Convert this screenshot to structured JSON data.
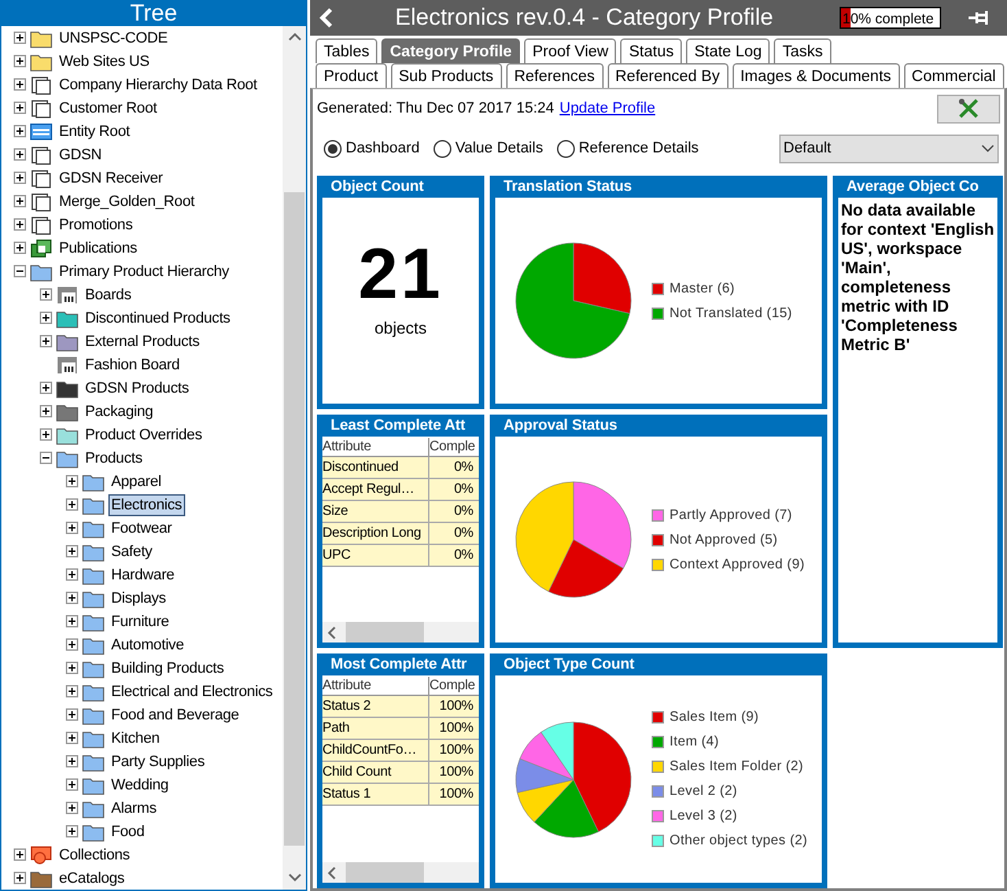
{
  "tree_panel": {
    "title": "Tree",
    "items": [
      {
        "label": "UNSPSC-CODE",
        "kind": "folder",
        "color": "#f9dc6b",
        "expanded": false,
        "selected": false
      },
      {
        "label": "Web Sites US",
        "kind": "folder",
        "color": "#f9dc6b",
        "expanded": false,
        "selected": false
      },
      {
        "label": "Company Hierarchy Data Root",
        "kind": "box",
        "expanded": false,
        "selected": false
      },
      {
        "label": "Customer Root",
        "kind": "box",
        "expanded": false,
        "selected": false
      },
      {
        "label": "Entity Root",
        "kind": "entity",
        "expanded": false,
        "selected": false
      },
      {
        "label": "GDSN",
        "kind": "box",
        "expanded": false,
        "selected": false
      },
      {
        "label": "GDSN Receiver",
        "kind": "box",
        "expanded": false,
        "selected": false
      },
      {
        "label": "Merge_Golden_Root",
        "kind": "box",
        "expanded": false,
        "selected": false
      },
      {
        "label": "Promotions",
        "kind": "box",
        "expanded": false,
        "selected": false
      },
      {
        "label": "Publications",
        "kind": "publication",
        "expanded": false,
        "selected": false
      },
      {
        "label": "Primary Product Hierarchy",
        "kind": "folder",
        "color": "#8cbcf0",
        "expanded": true,
        "selected": false,
        "children": [
          {
            "label": "Boards",
            "kind": "board",
            "expanded": false,
            "selected": false
          },
          {
            "label": "Discontinued Products",
            "kind": "folder",
            "color": "#2bbfb7",
            "expanded": false,
            "selected": false
          },
          {
            "label": "External Products",
            "kind": "folder",
            "color": "#9d97c0",
            "expanded": false,
            "selected": false
          },
          {
            "label": "Fashion Board",
            "kind": "board",
            "selected": false
          },
          {
            "label": "GDSN Products",
            "kind": "folder",
            "color": "#333333",
            "expanded": false,
            "selected": false
          },
          {
            "label": "Packaging",
            "kind": "folder",
            "color": "#777777",
            "expanded": false,
            "selected": false
          },
          {
            "label": "Product Overrides",
            "kind": "folder",
            "color": "#99e0dc",
            "expanded": false,
            "selected": false
          },
          {
            "label": "Products",
            "kind": "folder",
            "color": "#8cbcf0",
            "expanded": true,
            "selected": false,
            "children": [
              {
                "label": "Apparel",
                "kind": "folder",
                "color": "#8cbcf0",
                "expanded": false,
                "selected": false
              },
              {
                "label": "Electronics",
                "kind": "folder",
                "color": "#8cbcf0",
                "expanded": false,
                "selected": true
              },
              {
                "label": "Footwear",
                "kind": "folder",
                "color": "#8cbcf0",
                "expanded": false,
                "selected": false
              },
              {
                "label": "Safety",
                "kind": "folder",
                "color": "#8cbcf0",
                "expanded": false,
                "selected": false
              },
              {
                "label": "Hardware",
                "kind": "folder",
                "color": "#8cbcf0",
                "expanded": false,
                "selected": false
              },
              {
                "label": "Displays",
                "kind": "folder",
                "color": "#8cbcf0",
                "expanded": false,
                "selected": false
              },
              {
                "label": "Furniture",
                "kind": "folder",
                "color": "#8cbcf0",
                "expanded": false,
                "selected": false
              },
              {
                "label": "Automotive",
                "kind": "folder",
                "color": "#8cbcf0",
                "expanded": false,
                "selected": false
              },
              {
                "label": "Building Products",
                "kind": "folder",
                "color": "#8cbcf0",
                "expanded": false,
                "selected": false
              },
              {
                "label": "Electrical and Electronics",
                "kind": "folder",
                "color": "#8cbcf0",
                "expanded": false,
                "selected": false
              },
              {
                "label": "Food and Beverage",
                "kind": "folder",
                "color": "#8cbcf0",
                "expanded": false,
                "selected": false
              },
              {
                "label": "Kitchen",
                "kind": "folder",
                "color": "#8cbcf0",
                "expanded": false,
                "selected": false
              },
              {
                "label": "Party Supplies",
                "kind": "folder",
                "color": "#8cbcf0",
                "expanded": false,
                "selected": false
              },
              {
                "label": "Wedding",
                "kind": "folder",
                "color": "#8cbcf0",
                "expanded": false,
                "selected": false
              },
              {
                "label": "Alarms",
                "kind": "folder",
                "color": "#8cbcf0",
                "expanded": false,
                "selected": false
              },
              {
                "label": "Food",
                "kind": "folder",
                "color": "#8cbcf0",
                "expanded": false,
                "selected": false
              }
            ]
          }
        ]
      },
      {
        "label": "Collections",
        "kind": "collection",
        "expanded": false,
        "selected": false
      },
      {
        "label": "eCatalogs",
        "kind": "folder",
        "color": "#9a6a3a",
        "expanded": false,
        "selected": false
      }
    ]
  },
  "editor": {
    "title": "Electronics rev.0.4 - Category Profile",
    "progress": {
      "label": "10% complete",
      "level": 0.1
    },
    "tab_rows": [
      [
        {
          "label": "Tables",
          "selected": false
        },
        {
          "label": "Category Profile",
          "selected": true
        },
        {
          "label": "Proof View",
          "selected": false
        },
        {
          "label": "Status",
          "selected": false
        },
        {
          "label": "State Log",
          "selected": false
        },
        {
          "label": "Tasks",
          "selected": false
        }
      ],
      [
        {
          "label": "Product",
          "selected": false
        },
        {
          "label": "Sub Products",
          "selected": false
        },
        {
          "label": "References",
          "selected": false
        },
        {
          "label": "Referenced By",
          "selected": false
        },
        {
          "label": "Images & Documents",
          "selected": false
        },
        {
          "label": "Commercial",
          "selected": false
        }
      ]
    ],
    "generated": "Generated: Thu Dec 07 2017 15:24",
    "update_link": "Update Profile",
    "view_options": [
      {
        "label": "Dashboard",
        "selected": true
      },
      {
        "label": "Value Details",
        "selected": false
      },
      {
        "label": "Reference Details",
        "selected": false
      }
    ],
    "dropdown": {
      "value": "Default"
    },
    "panels": [
      {
        "kind": "count",
        "title": "Object Count",
        "value": "21",
        "unit": "objects"
      },
      {
        "kind": "chart",
        "title": "Translation Status",
        "chart_data": {
          "type": "pie",
          "legend": "right",
          "categories": [
            "Master (6)",
            "Not Translated (15)"
          ],
          "values": [
            6,
            15
          ],
          "colors": [
            "#e00000",
            "#00a800"
          ]
        }
      },
      {
        "kind": "message",
        "title": "Average Object Co",
        "text": "No data available for context 'English US', workspace 'Main', completeness metric with ID 'Completeness Metric B'"
      },
      {
        "kind": "table",
        "title": "Least Complete Att",
        "columns": [
          "Attribute",
          "Comple"
        ],
        "rows": [
          [
            "Discontinued",
            "0%"
          ],
          [
            "Accept Regul…",
            "0%"
          ],
          [
            "Size",
            "0%"
          ],
          [
            "Description Long",
            "0%"
          ],
          [
            "UPC",
            "0%"
          ]
        ]
      },
      {
        "kind": "chart",
        "title": "Approval Status",
        "chart_data": {
          "type": "pie",
          "legend": "right",
          "categories": [
            "Partly Approved (7)",
            "Not Approved (5)",
            "Context Approved (9)"
          ],
          "values": [
            7,
            5,
            9
          ],
          "colors": [
            "#ff66e6",
            "#e00000",
            "#ffd700"
          ]
        }
      },
      {
        "kind": "table",
        "title": "Most Complete Attr",
        "columns": [
          "Attribute",
          "Comple"
        ],
        "rows": [
          [
            "Status 2",
            "100%"
          ],
          [
            "Path",
            "100%"
          ],
          [
            "ChildCountFo…",
            "100%"
          ],
          [
            "Child Count",
            "100%"
          ],
          [
            "Status 1",
            "100%"
          ]
        ]
      },
      {
        "kind": "chart",
        "title": "Object Type Count",
        "chart_data": {
          "type": "pie",
          "legend": "right",
          "categories": [
            "Sales Item (9)",
            "Item (4)",
            "Sales Item Folder (2)",
            "Level 2 (2)",
            "Level 3 (2)",
            "Other object types (2)"
          ],
          "values": [
            9,
            4,
            2,
            2,
            2,
            2
          ],
          "colors": [
            "#e00000",
            "#00a800",
            "#ffd700",
            "#7b8de8",
            "#ff66e6",
            "#66ffe6"
          ]
        }
      }
    ]
  }
}
